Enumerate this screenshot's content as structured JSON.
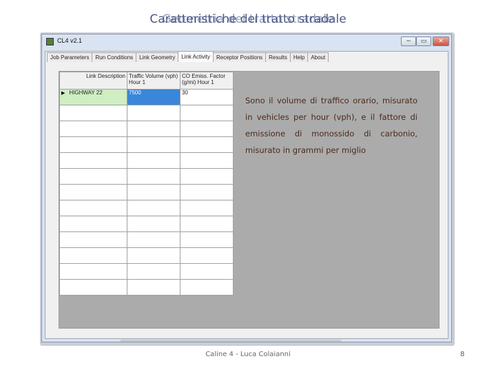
{
  "slide": {
    "title_layer1": "Caratteristiche del tratto stradale",
    "title_layer2": "Geometria del tratto stradale",
    "footer": "Caline 4 - Luca Colaianni",
    "page_number": "8"
  },
  "window": {
    "title": "CL4 v2.1",
    "buttons": {
      "minimize": "−",
      "maximize": "▭",
      "close": "✕"
    }
  },
  "tabs": [
    {
      "label": "Job Parameters"
    },
    {
      "label": "Run Conditions"
    },
    {
      "label": "Link Geometry"
    },
    {
      "label": "Link Activity",
      "active": true
    },
    {
      "label": "Receptor Positions"
    },
    {
      "label": "Results"
    },
    {
      "label": "Help"
    },
    {
      "label": "About"
    }
  ],
  "grid": {
    "headers": {
      "row_header": "Link Description",
      "traffic_volume": "Traffic Volume (vph) Hour 1",
      "co_emission": "CO Emiss. Factor (g/mi) Hour 1"
    },
    "rows": [
      {
        "name": "HIGHWAY 22",
        "volume": "7500",
        "co": "30"
      }
    ]
  },
  "callout": {
    "text": "Sono il volume di traffico orario, misurato in vehicles per hour (vph), e il fattore di emissione di monossido di carbonio, misurato in grammi per miglio"
  }
}
